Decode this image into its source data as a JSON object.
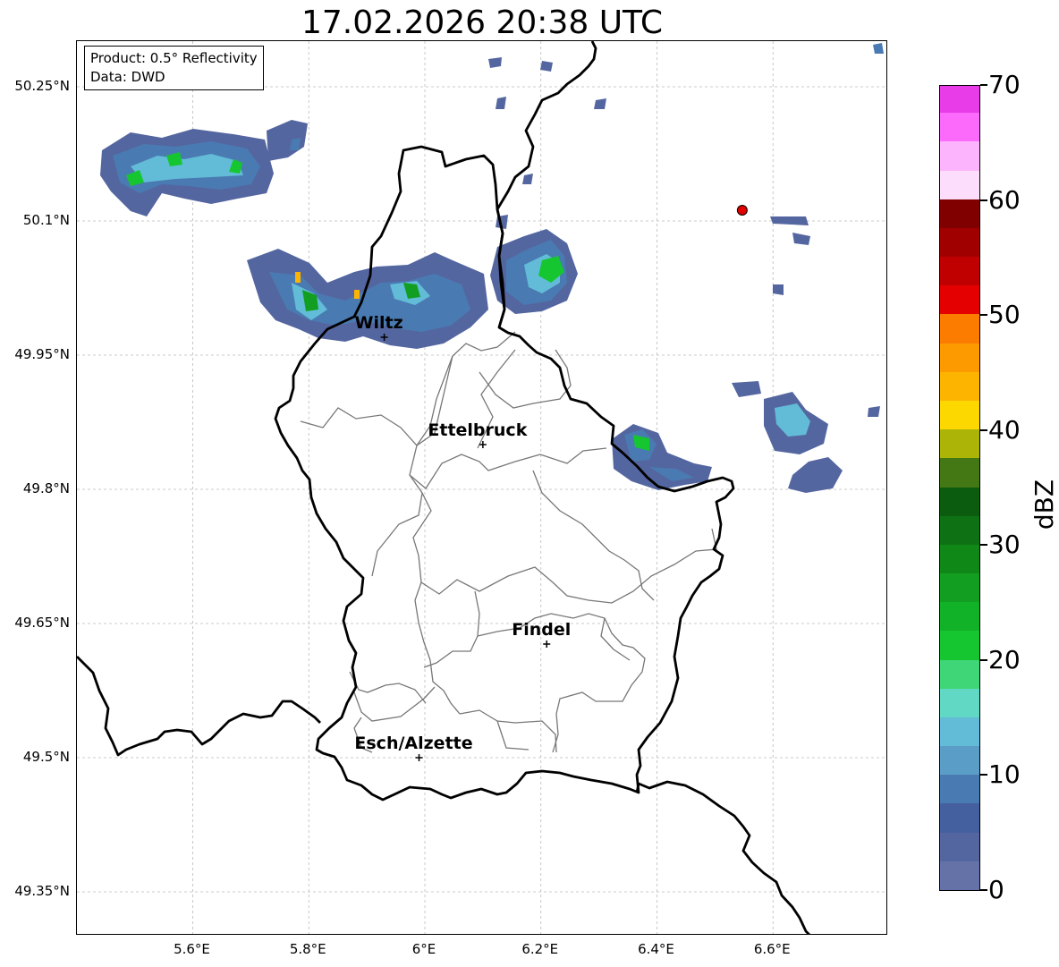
{
  "title": "17.02.2026 20:38 UTC",
  "info": {
    "product": "Product: 0.5° Reflectivity",
    "data": "Data: DWD"
  },
  "map": {
    "lat_ticks": [
      {
        "value": 50.25,
        "label": "50.25°N"
      },
      {
        "value": 50.1,
        "label": "50.1°N"
      },
      {
        "value": 49.95,
        "label": "49.95°N"
      },
      {
        "value": 49.8,
        "label": "49.8°N"
      },
      {
        "value": 49.65,
        "label": "49.65°N"
      },
      {
        "value": 49.5,
        "label": "49.5°N"
      },
      {
        "value": 49.35,
        "label": "49.35°N"
      }
    ],
    "lon_ticks": [
      {
        "value": 5.6,
        "label": "5.6°E"
      },
      {
        "value": 5.8,
        "label": "5.8°E"
      },
      {
        "value": 6.0,
        "label": "6°E"
      },
      {
        "value": 6.2,
        "label": "6.2°E"
      },
      {
        "value": 6.4,
        "label": "6.4°E"
      },
      {
        "value": 6.6,
        "label": "6.6°E"
      }
    ],
    "cities": [
      {
        "name": "Wiltz",
        "lon": 5.93,
        "lat": 49.97
      },
      {
        "name": "Ettelbruck",
        "lon": 6.1,
        "lat": 49.85
      },
      {
        "name": "Findel",
        "lon": 6.21,
        "lat": 49.627
      },
      {
        "name": "Esch/Alzette",
        "lon": 5.99,
        "lat": 49.5
      }
    ],
    "radar_site": {
      "lon": 6.547,
      "lat": 50.112,
      "color": "#e00000"
    }
  },
  "colorbar": {
    "unit": "dBZ",
    "min": 0,
    "max": 70,
    "ticks": [
      {
        "value": 70,
        "label": "70"
      },
      {
        "value": 60,
        "label": "60"
      },
      {
        "value": 50,
        "label": "50"
      },
      {
        "value": 40,
        "label": "40"
      },
      {
        "value": 30,
        "label": "30"
      },
      {
        "value": 20,
        "label": "20"
      },
      {
        "value": 10,
        "label": "10"
      },
      {
        "value": 0,
        "label": "0"
      }
    ],
    "colors": [
      "#6472a8",
      "#5466a0",
      "#44609e",
      "#4a7ab2",
      "#5a9ec8",
      "#62bcd8",
      "#60d8c4",
      "#3ed676",
      "#16c630",
      "#12b228",
      "#129e20",
      "#108818",
      "#0e7214",
      "#0c5c10",
      "#447814",
      "#acb408",
      "#fcd800",
      "#fcb400",
      "#fc9a00",
      "#fc7c00",
      "#e40000",
      "#c00000",
      "#a00000",
      "#800000",
      "#fcdefc",
      "#fcb4fc",
      "#fc6afc",
      "#e83ce8"
    ]
  }
}
